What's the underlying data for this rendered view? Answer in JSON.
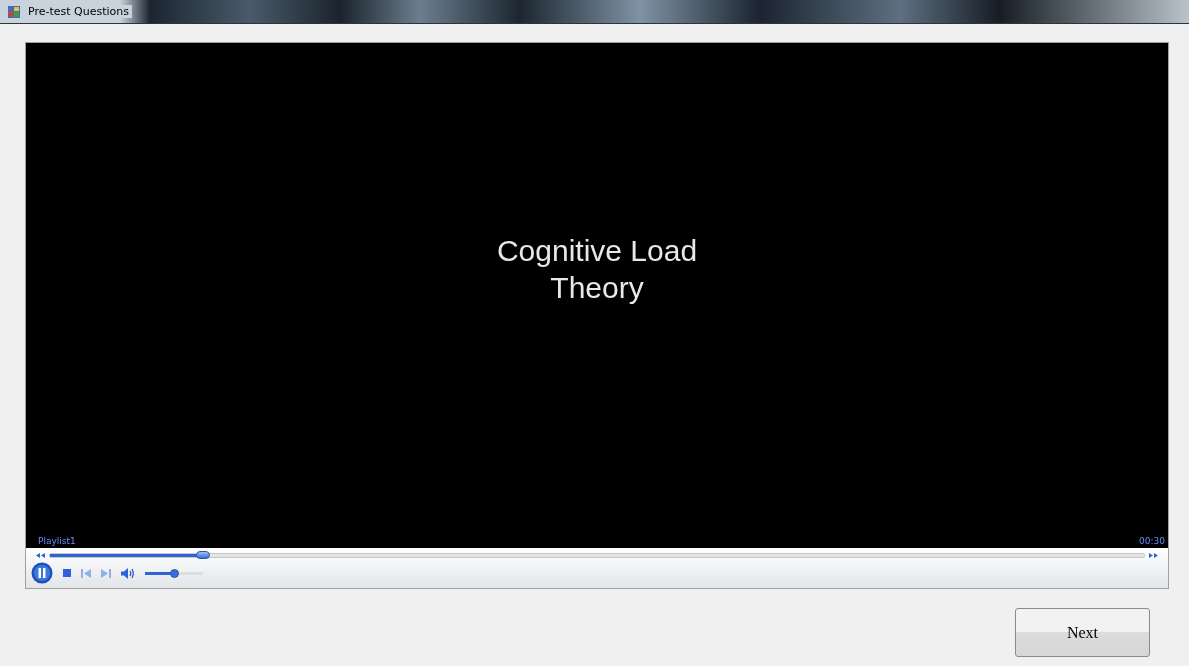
{
  "window": {
    "title": "Pre-test Questions"
  },
  "player": {
    "slide_text": "Cognitive Load Theory",
    "playlist": "Playlist1",
    "time": "00:30",
    "seek": {
      "level": 0.14
    },
    "volume": {
      "level": 0.5
    },
    "playing": true
  },
  "buttons": [
    {
      "label": "Next"
    }
  ]
}
